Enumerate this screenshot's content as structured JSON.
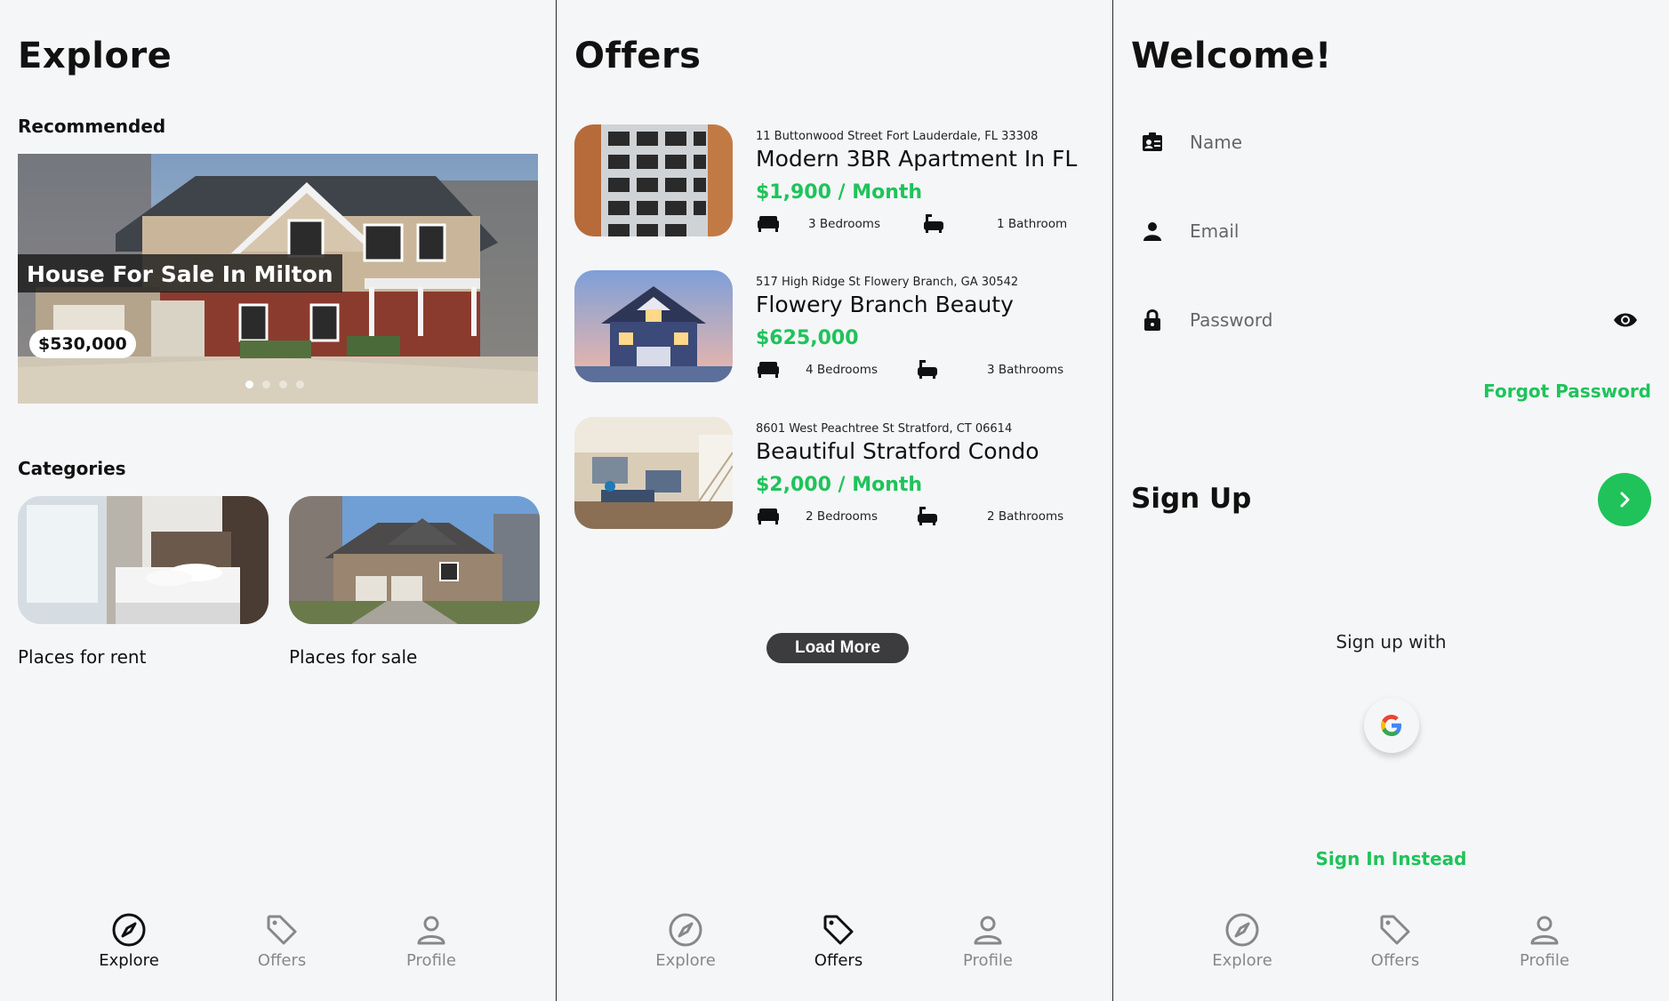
{
  "explore": {
    "title": "Explore",
    "recommended_label": "Recommended",
    "hero": {
      "title": "House For Sale In Milton",
      "price": "$530,000",
      "slides": 4,
      "active_slide": 1
    },
    "categories_label": "Categories",
    "categories": [
      {
        "label": "Places for rent",
        "image": "bedroom-photo"
      },
      {
        "label": "Places for sale",
        "image": "stone-house-photo"
      }
    ]
  },
  "offers": {
    "title": "Offers",
    "items": [
      {
        "address": "11 Buttonwood Street Fort Lauderdale, FL 33308",
        "title": "Modern 3BR Apartment In FL",
        "price": "$1,900 / Month",
        "bedrooms": "3 Bedrooms",
        "bathrooms": "1 Bathroom"
      },
      {
        "address": "517 High Ridge St Flowery Branch, GA 30542",
        "title": "Flowery Branch Beauty",
        "price": "$625,000",
        "bedrooms": "4 Bedrooms",
        "bathrooms": "3 Bathrooms"
      },
      {
        "address": "8601 West Peachtree St Stratford, CT 06614",
        "title": "Beautiful Stratford Condo",
        "price": "$2,000 / Month",
        "bedrooms": "2 Bedrooms",
        "bathrooms": "2 Bathrooms"
      }
    ],
    "load_more": "Load More"
  },
  "welcome": {
    "title": "Welcome!",
    "name_placeholder": "Name",
    "email_placeholder": "Email",
    "password_placeholder": "Password",
    "forgot_password": "Forgot Password",
    "sign_up": "Sign Up",
    "sign_up_with": "Sign up with",
    "sign_in_instead": "Sign In Instead"
  },
  "nav": {
    "explore": "Explore",
    "offers": "Offers",
    "profile": "Profile"
  },
  "colors": {
    "accent": "#1fc35a",
    "dark_button": "#3c3c3e",
    "background": "#f5f6f8"
  }
}
